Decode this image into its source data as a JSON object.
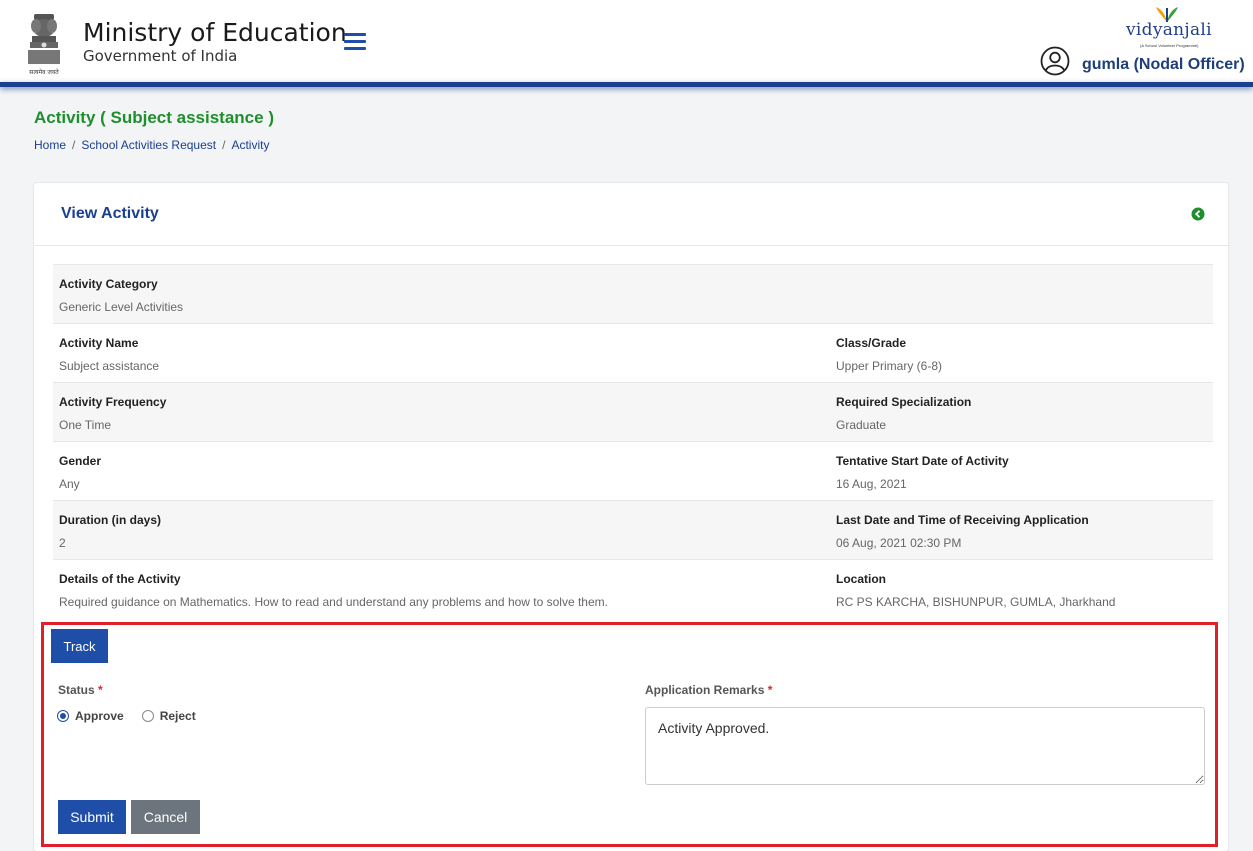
{
  "header": {
    "title": "Ministry of Education",
    "subtitle": "Government of India",
    "emblem_caption": "सत्यमेव जयते",
    "logo_text": "vidyanjali",
    "logo_tagline": "(A School Volunteer Programme)",
    "user_label": "gumla (Nodal Officer)"
  },
  "page": {
    "title": "Activity ( Subject assistance )",
    "breadcrumb": [
      "Home",
      "School Activities Request",
      "Activity"
    ]
  },
  "card": {
    "title": "View Activity",
    "fields": {
      "category_label": "Activity Category",
      "category_value": "Generic Level Activities",
      "name_label": "Activity Name",
      "name_value": "Subject assistance",
      "class_label": "Class/Grade",
      "class_value": "Upper Primary (6-8)",
      "frequency_label": "Activity Frequency",
      "frequency_value": "One Time",
      "specialization_label": "Required Specialization",
      "specialization_value": "Graduate",
      "gender_label": "Gender",
      "gender_value": "Any",
      "start_label": "Tentative Start Date of Activity",
      "start_value": "16 Aug, 2021",
      "duration_label": "Duration (in days)",
      "duration_value": "2",
      "last_date_label": "Last Date and Time of Receiving Application",
      "last_date_value": "06 Aug, 2021 02:30 PM",
      "details_label": "Details of the Activity",
      "details_value": "Required guidance on Mathematics. How to read and understand any problems and how to solve them.",
      "location_label": "Location",
      "location_value": "RC PS KARCHA, BISHUNPUR, GUMLA, Jharkhand"
    }
  },
  "form": {
    "track_label": "Track",
    "status_label": "Status",
    "required_mark": "*",
    "approve_label": "Approve",
    "reject_label": "Reject",
    "selected_status": "Approve",
    "remarks_label": "Application Remarks",
    "remarks_value": "Activity Approved.",
    "submit_label": "Submit",
    "cancel_label": "Cancel"
  },
  "colors": {
    "brand_blue": "#1b3f8f",
    "button_blue": "#1f4ea8",
    "title_green": "#1f8f2e",
    "highlight_red": "#e01f2a",
    "cancel_gray": "#6c757d"
  }
}
